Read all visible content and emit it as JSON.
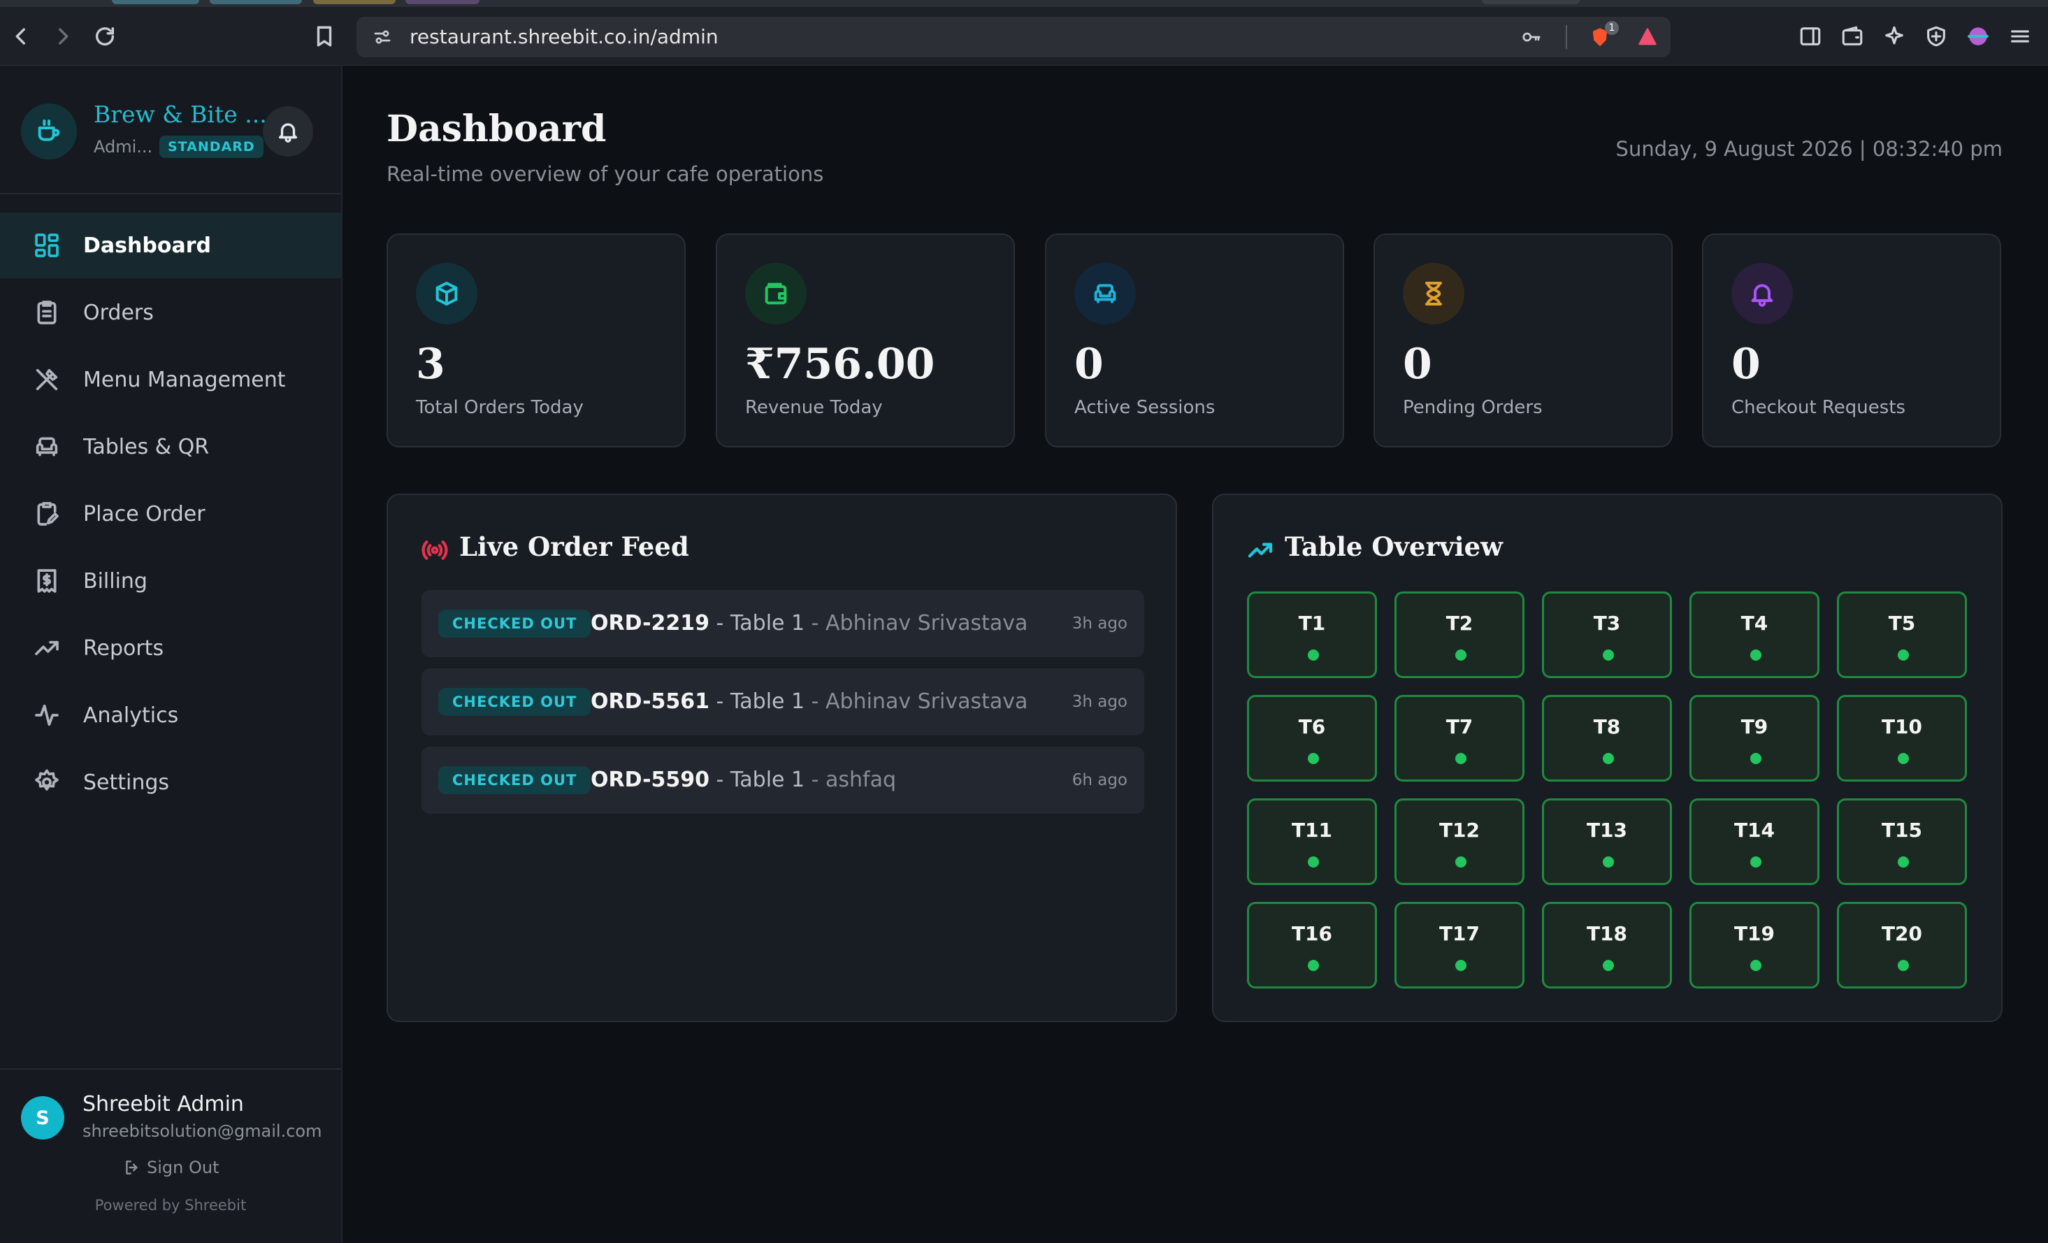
{
  "browser": {
    "url": "restaurant.shreebit.co.in/admin",
    "extension_badge": "1"
  },
  "sidebar": {
    "brand_name": "Brew & Bite ...",
    "role": "Admi...",
    "plan_badge": "STANDARD",
    "nav": [
      {
        "label": "Dashboard",
        "icon": "dashboard-grid-icon",
        "active": true
      },
      {
        "label": "Orders",
        "icon": "clipboard-list-icon"
      },
      {
        "label": "Menu Management",
        "icon": "utensils-icon"
      },
      {
        "label": "Tables & QR",
        "icon": "armchair-icon"
      },
      {
        "label": "Place Order",
        "icon": "clipboard-edit-icon"
      },
      {
        "label": "Billing",
        "icon": "receipt-icon"
      },
      {
        "label": "Reports",
        "icon": "trending-up-icon"
      },
      {
        "label": "Analytics",
        "icon": "activity-icon"
      },
      {
        "label": "Settings",
        "icon": "gear-icon"
      }
    ],
    "user": {
      "initial": "S",
      "name": "Shreebit Admin",
      "email": "shreebitsolution@gmail.com"
    },
    "sign_out": "Sign Out",
    "powered_by": "Powered by Shreebit"
  },
  "header": {
    "title": "Dashboard",
    "subtitle": "Real-time overview of your cafe operations",
    "datetime": "Sunday, 9 August 2026 | 08:32:40 pm"
  },
  "stats": [
    {
      "value": "3",
      "label": "Total Orders Today",
      "icon": "package-icon",
      "color": "#22c4d6",
      "bg": "#12303a"
    },
    {
      "value": "₹756.00",
      "label": "Revenue Today",
      "icon": "wallet-icon",
      "color": "#22c55e",
      "bg": "#133024"
    },
    {
      "value": "0",
      "label": "Active Sessions",
      "icon": "armchair-icon",
      "color": "#22b0d6",
      "bg": "#12283a"
    },
    {
      "value": "0",
      "label": "Pending Orders",
      "icon": "hourglass-icon",
      "color": "#e0a030",
      "bg": "#33291a"
    },
    {
      "value": "0",
      "label": "Checkout Requests",
      "icon": "bell-icon",
      "color": "#a855f7",
      "bg": "#2a1f3c"
    }
  ],
  "live_feed": {
    "title": "Live Order Feed",
    "orders": [
      {
        "status": "CHECKED OUT",
        "id": "ORD-2219",
        "table": " - Table 1",
        "customer": " - Abhinav Srivastava",
        "time": "3h ago"
      },
      {
        "status": "CHECKED OUT",
        "id": "ORD-5561",
        "table": " - Table 1",
        "customer": " - Abhinav Srivastava",
        "time": "3h ago"
      },
      {
        "status": "CHECKED OUT",
        "id": "ORD-5590",
        "table": " - Table 1",
        "customer": " - ashfaq",
        "time": "6h ago"
      }
    ]
  },
  "table_overview": {
    "title": "Table Overview",
    "status_color": "#22c55e",
    "tables": [
      "T1",
      "T2",
      "T3",
      "T4",
      "T5",
      "T6",
      "T7",
      "T8",
      "T9",
      "T10",
      "T11",
      "T12",
      "T13",
      "T14",
      "T15",
      "T16",
      "T17",
      "T18",
      "T19",
      "T20"
    ]
  }
}
